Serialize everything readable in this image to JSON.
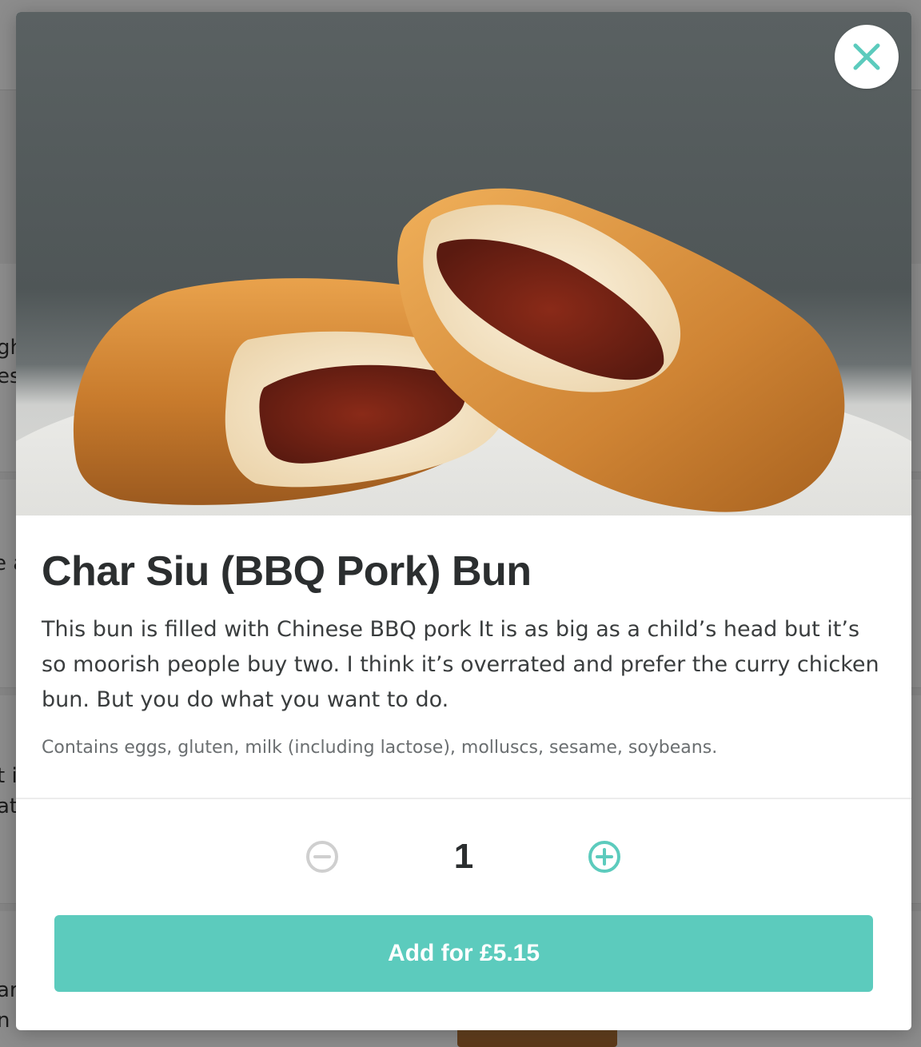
{
  "background_page": {
    "fragments": [
      "gh",
      "es",
      "e a",
      "t i",
      "at",
      "ar",
      "n"
    ]
  },
  "modal": {
    "hero_image_alt": "Char Siu bun cut open showing BBQ pork filling",
    "close_icon": "close-icon",
    "title": "Char Siu (BBQ Pork) Bun",
    "description": "This bun is filled with Chinese BBQ pork It is as big as a child’s head but it’s so moorish people buy two. I think it’s overrated and prefer the curry chicken bun. But you do what you want to do.",
    "allergens": "Contains eggs, gluten, milk (including lactose), molluscs, sesame, soybeans.",
    "quantity": {
      "decrement_icon": "minus-circle-icon",
      "value": "1",
      "increment_icon": "plus-circle-icon"
    },
    "add_button_label": "Add for £5.15"
  },
  "colors": {
    "accent": "#5ccbbd",
    "disabled": "#cfcfcf",
    "title_text": "#2b2e2f",
    "overlay": "#8a8a8a"
  }
}
